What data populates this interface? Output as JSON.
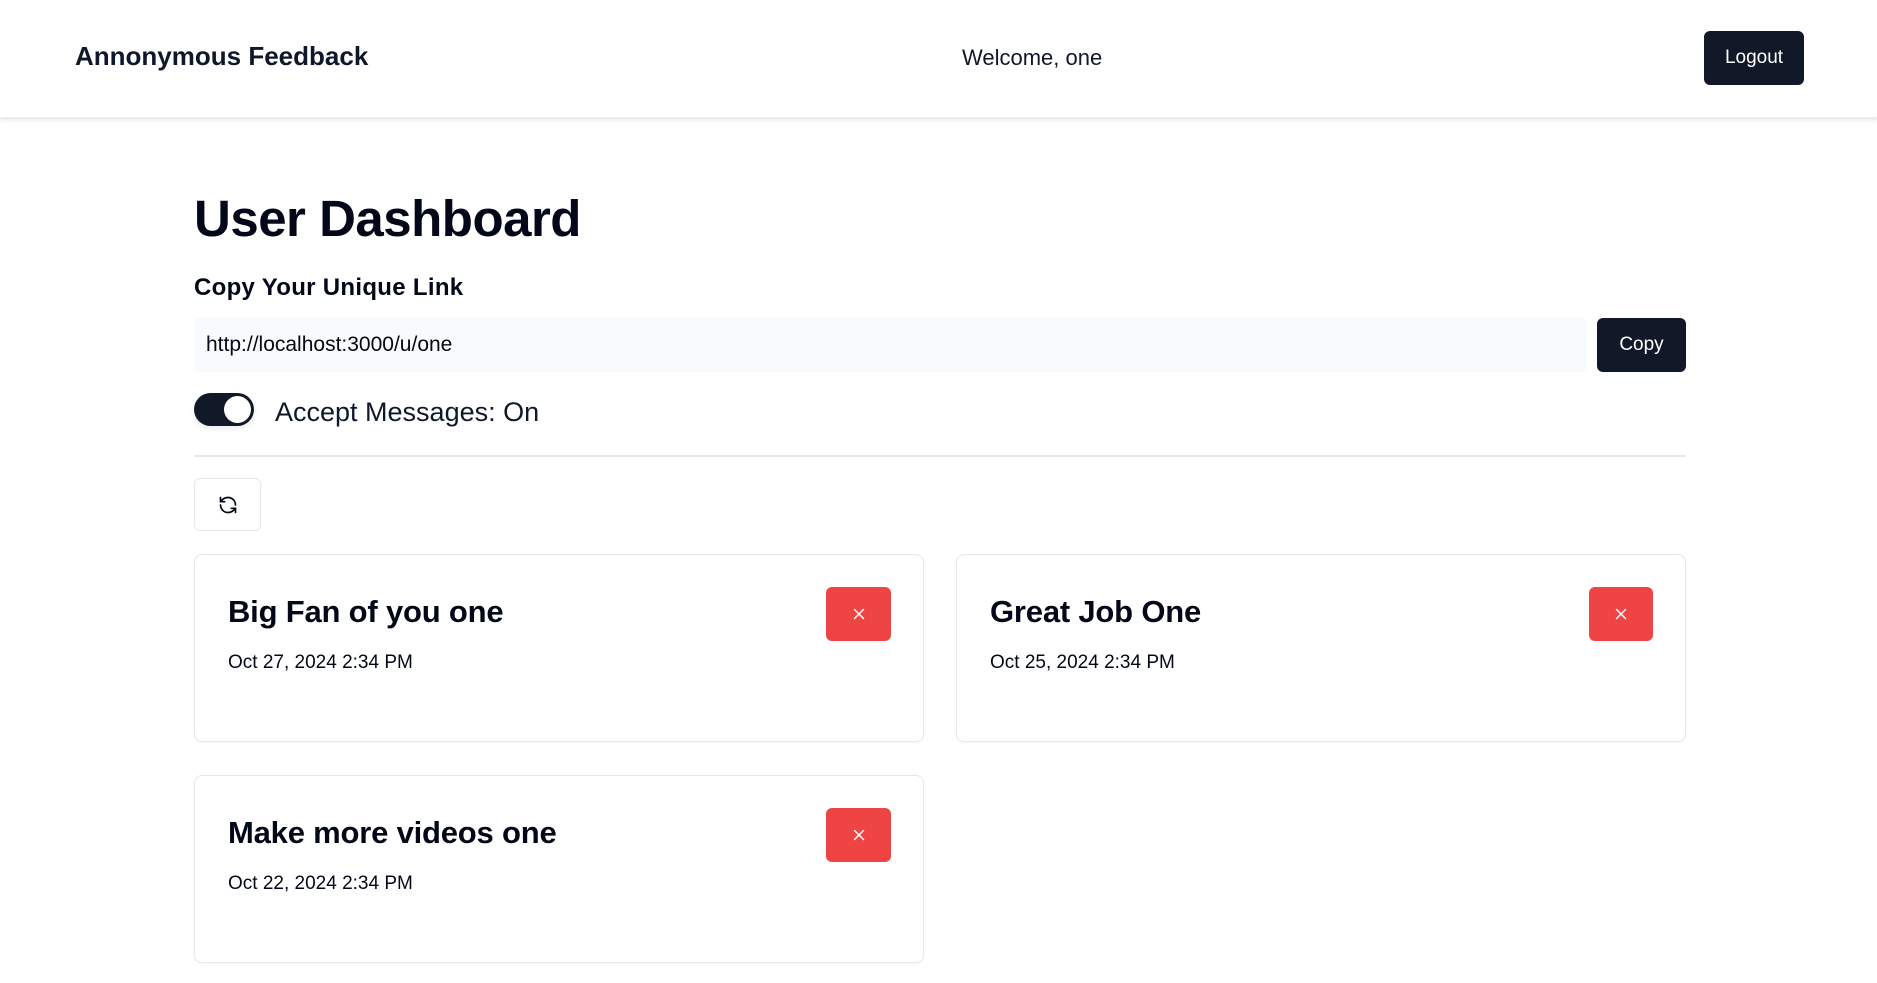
{
  "header": {
    "brand": "Annonymous Feedback",
    "welcome": "Welcome, one",
    "logout_label": "Logout"
  },
  "dashboard": {
    "title": "User Dashboard",
    "link_section_label": "Copy Your Unique Link",
    "unique_link": "http://localhost:3000/u/one",
    "copy_label": "Copy",
    "accept_messages_label": "Accept Messages: On",
    "accept_messages_on": true,
    "refresh_icon": "refresh-icon"
  },
  "messages": [
    {
      "content": "Big Fan of you one",
      "date": "Oct 27, 2024 2:34 PM"
    },
    {
      "content": "Great Job One",
      "date": "Oct 25, 2024 2:34 PM"
    },
    {
      "content": "Make more videos one",
      "date": "Oct 22, 2024 2:34 PM"
    }
  ],
  "colors": {
    "primary": "#111827",
    "danger": "#ef4444",
    "border": "#e5e7eb",
    "input_bg": "#f9fafb"
  }
}
